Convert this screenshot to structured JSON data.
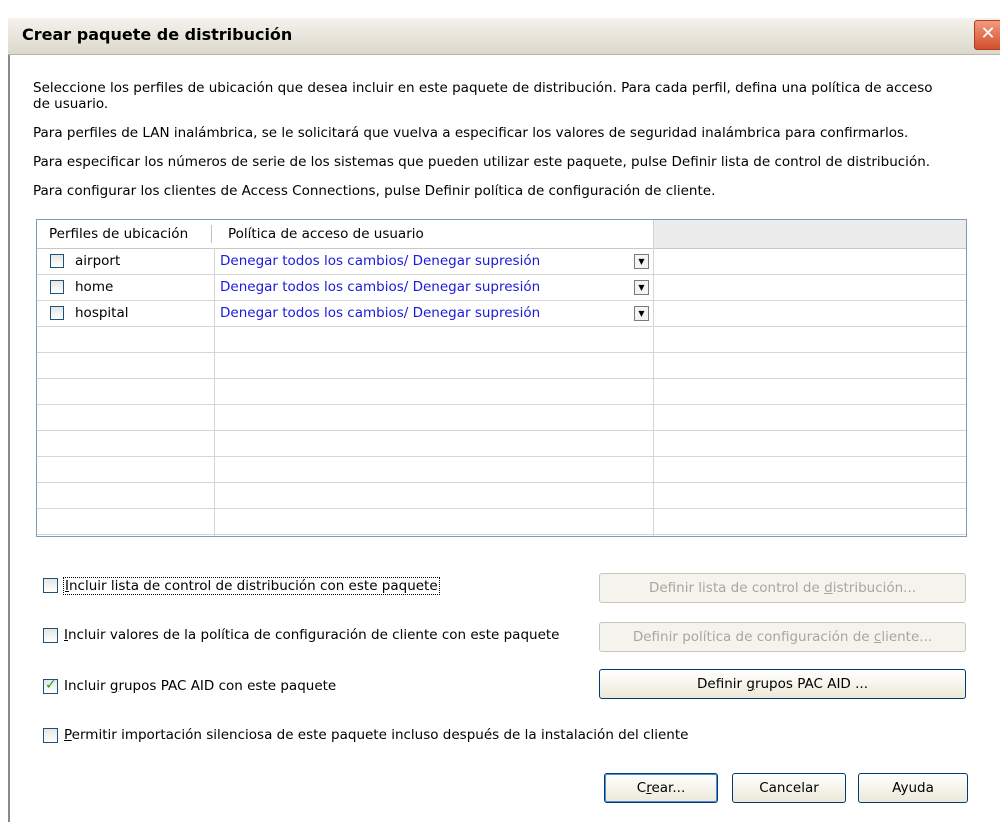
{
  "window": {
    "title": "Crear paquete de distribución"
  },
  "instructions": {
    "line1a": "Seleccione los perfiles de ubicación que desea incluir en este paquete de distribución. Para cada perfil, defina una política de acceso",
    "line1b": "de usuario.",
    "line2": "Para perfiles de LAN inalámbrica, se le solicitará que vuelva a especificar los valores de seguridad inalámbrica para confirmarlos.",
    "line3": "Para especificar los números de serie de los sistemas que pueden utilizar este paquete, pulse Definir lista de control de distribución.",
    "line4": "Para configurar los clientes de Access Connections, pulse Definir política de configuración de cliente."
  },
  "table": {
    "headers": [
      "Perfiles de ubicación",
      "Política de acceso de usuario"
    ],
    "rows": [
      {
        "checked": false,
        "name": "airport",
        "policy": "Denegar todos los cambios/ Denegar supresión"
      },
      {
        "checked": false,
        "name": "home",
        "policy": "Denegar todos los cambios/ Denegar supresión"
      },
      {
        "checked": false,
        "name": "hospital",
        "policy": "Denegar todos los cambios/ Denegar supresión"
      }
    ]
  },
  "options": {
    "dist_list": {
      "checked": false,
      "label_first": "I",
      "label_rest": "ncluir lista de control de distribución con este paquete"
    },
    "config_policy": {
      "checked": false,
      "label_first": "I",
      "label_rest": "ncluir valores de la política de configuración de cliente con este paquete"
    },
    "pac_groups": {
      "checked": true,
      "label_pre": "Incluir ",
      "label_u": "g",
      "label_post": "rupos PAC AID con este paquete"
    },
    "silent_import": {
      "checked": false,
      "label_first": "P",
      "label_rest": "ermitir importación silenciosa de este paquete incluso después de la instalación del cliente"
    }
  },
  "buttons": {
    "define_dist_pre": "Definir lista de control de ",
    "define_dist_u": "d",
    "define_dist_post": "istribución...",
    "define_config_pre": "Definir política de configuración de ",
    "define_config_u": "c",
    "define_config_post": "liente...",
    "define_pac_pre": "Definir ",
    "define_pac_u": "g",
    "define_pac_post": "rupos PAC AID ...",
    "create_pre": "C",
    "create_u": "r",
    "create_post": "ear...",
    "cancel": "Cancelar",
    "help": "Ayuda"
  }
}
